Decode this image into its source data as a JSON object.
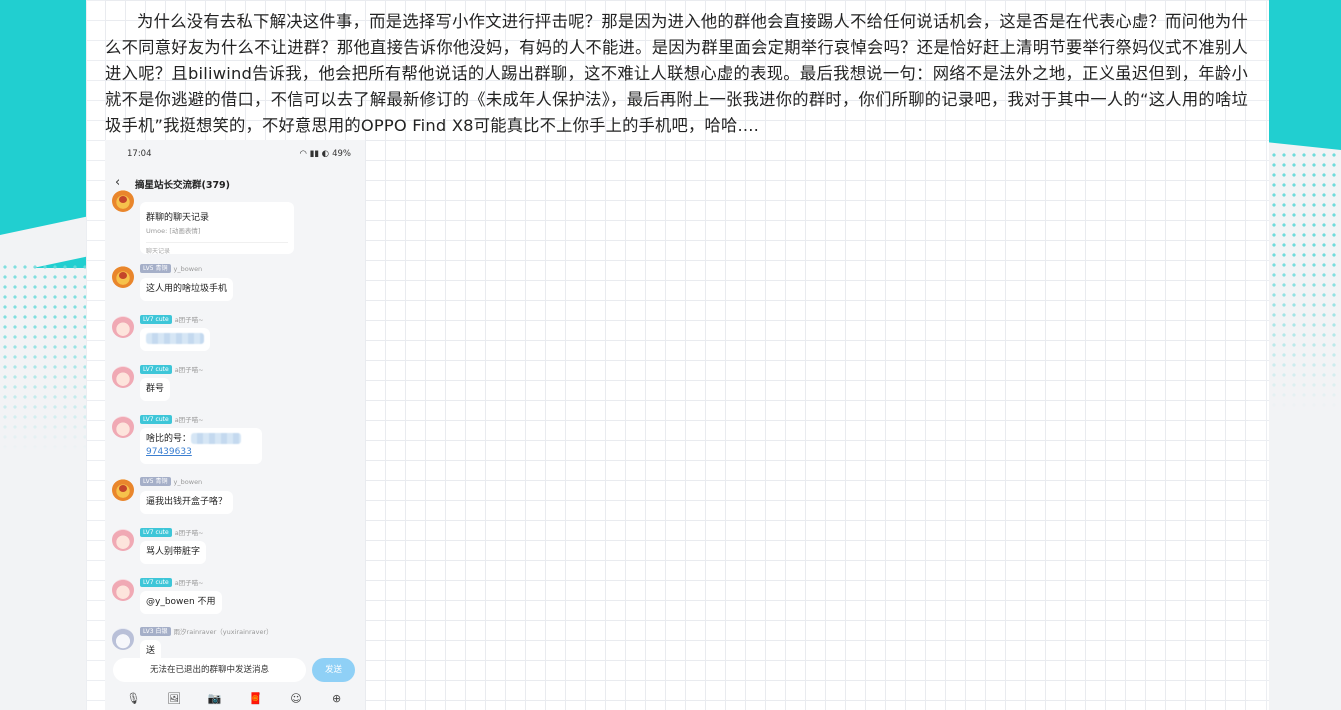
{
  "article": {
    "paragraph": "为什么没有去私下解决这件事，而是选择写小作文进行抨击呢？那是因为进入他的群他会直接踢人不给任何说话机会，这是否是在代表心虚？而问他为什么不同意好友为什么不让进群？那他直接告诉你他没妈，有妈的人不能进。是因为群里面会定期举行哀悼会吗？还是恰好赶上清明节要举行祭妈仪式不准别人进入呢？且biliwind告诉我，他会把所有帮他说话的人踢出群聊，这不难让人联想心虚的表现。最后我想说一句：网络不是法外之地，正义虽迟但到，年龄小就不是你逃避的借口，不信可以去了解最新修订的《未成年人保护法》，最后再附上一张我进你的群时，你们所聊的记录吧，我对于其中一人的“这人用的啥垃圾手机”我挺想笑的，不好意思用的OPPO Find X8可能真比不上你手上的手机吧，哈哈...."
  },
  "phone": {
    "status_time": "17:04",
    "status_battery": "49%",
    "status_icons": "◠ ▮▮ ◐",
    "group_title": "摘星站长交流群(379)",
    "record_card": {
      "title": "群聊的聊天记录",
      "subtitle": "Umoe: [动画表情]",
      "footer": "聊天记录"
    },
    "messages": [
      {
        "avatar": "lion",
        "level": "LV5",
        "badge": "青铜",
        "badge_color": "gray",
        "name": "y_bowen",
        "text": "这人用的啥垃圾手机"
      },
      {
        "avatar": "girl",
        "level": "LV7",
        "badge": "cute",
        "badge_color": "cyan",
        "name": "a团子喵~",
        "text": ""
      },
      {
        "avatar": "girl",
        "level": "LV7",
        "badge": "cute",
        "badge_color": "cyan",
        "name": "a团子喵~",
        "text": "群号"
      },
      {
        "avatar": "girl",
        "level": "LV7",
        "badge": "cute",
        "badge_color": "cyan",
        "name": "a团子喵~",
        "text": "啥比的号：",
        "link": "97439633"
      },
      {
        "avatar": "lion",
        "level": "LV5",
        "badge": "青铜",
        "badge_color": "gray",
        "name": "y_bowen",
        "text": "逼我出钱开盒子咯？"
      },
      {
        "avatar": "girl",
        "level": "LV7",
        "badge": "cute",
        "badge_color": "cyan",
        "name": "a团子喵~",
        "text": "骂人别带脏字"
      },
      {
        "avatar": "girl",
        "level": "LV7",
        "badge": "cute",
        "badge_color": "cyan",
        "name": "a团子喵~",
        "text": "@y_bowen 不用"
      },
      {
        "avatar": "white",
        "level": "LV3",
        "badge": "白银",
        "badge_color": "gray",
        "name": "雨汐rainraver（yuxirainraver）",
        "text": "送"
      }
    ],
    "input_placeholder": "无法在已退出的群聊中发送消息",
    "send_label": "发送",
    "toolbar_icons": [
      "mic-icon",
      "image-icon",
      "camera-icon",
      "red-packet-icon",
      "emoji-icon",
      "plus-icon"
    ]
  },
  "colors": {
    "accent": "#21cfd0",
    "link": "#3b7fd1",
    "send_button": "#8fd0f6"
  }
}
